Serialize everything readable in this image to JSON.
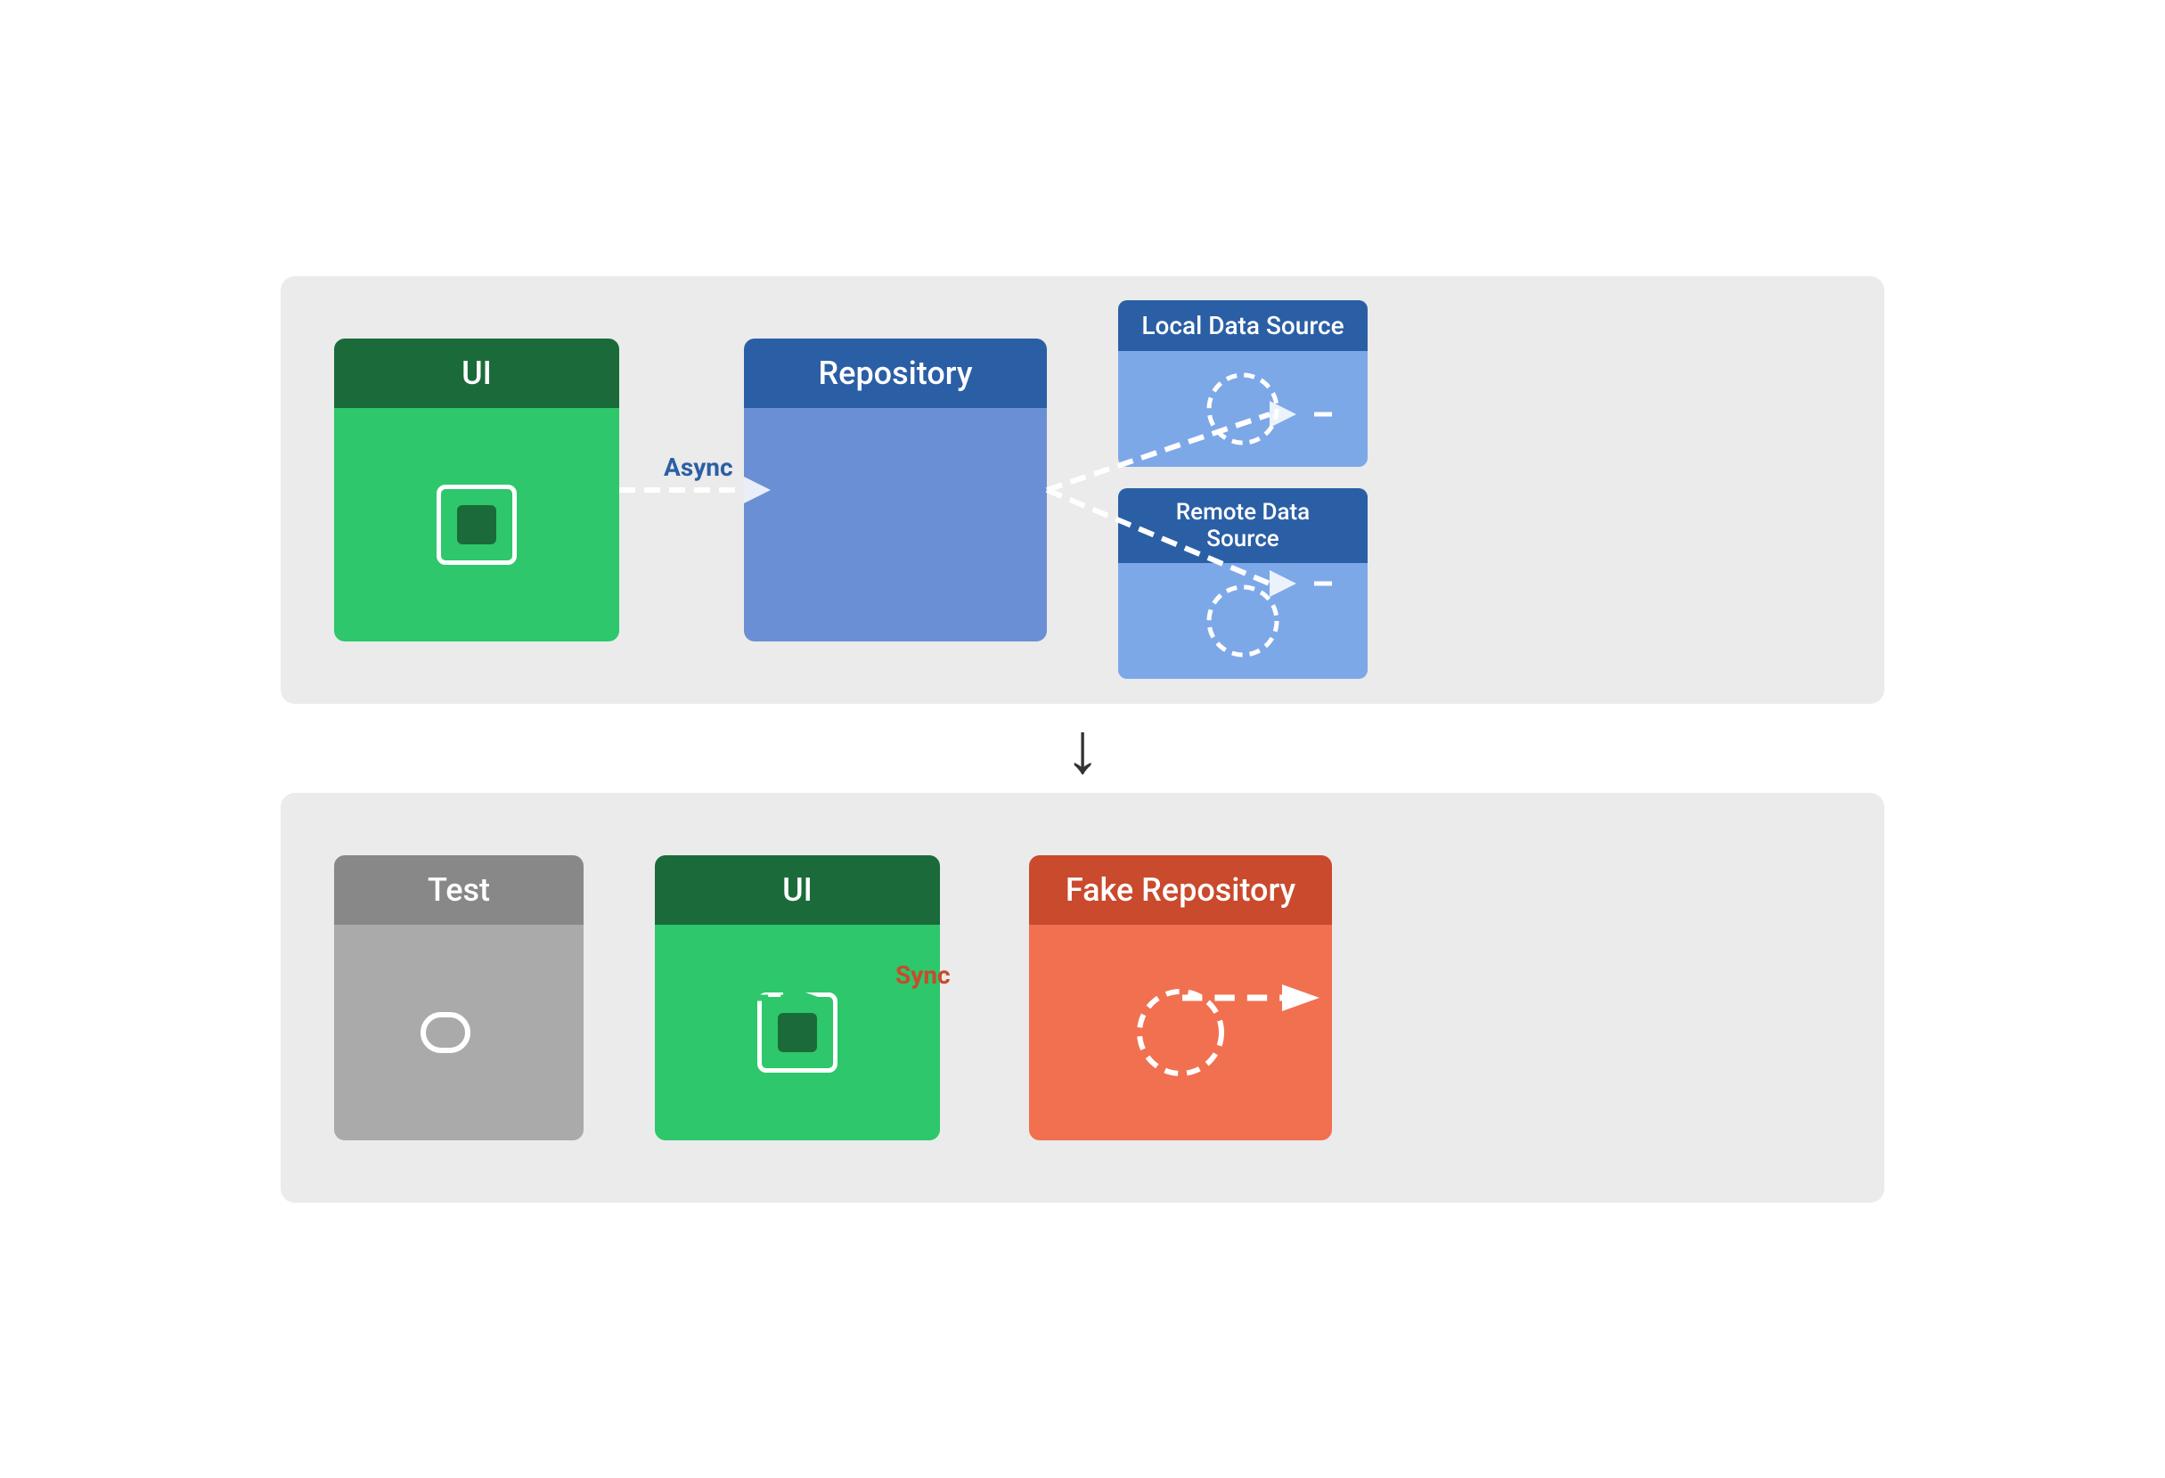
{
  "top_diagram": {
    "ui": {
      "header": "UI"
    },
    "repo": {
      "header": "Repository"
    },
    "local_ds": {
      "header": "Local Data Source"
    },
    "remote_ds": {
      "header": "Remote Data\nSource"
    },
    "async_label": "Async"
  },
  "down_arrow": "↓",
  "bottom_diagram": {
    "test": {
      "header": "Test"
    },
    "ui": {
      "header": "UI"
    },
    "fake_repo": {
      "header": "Fake Repository"
    },
    "sync_label": "Sync"
  }
}
